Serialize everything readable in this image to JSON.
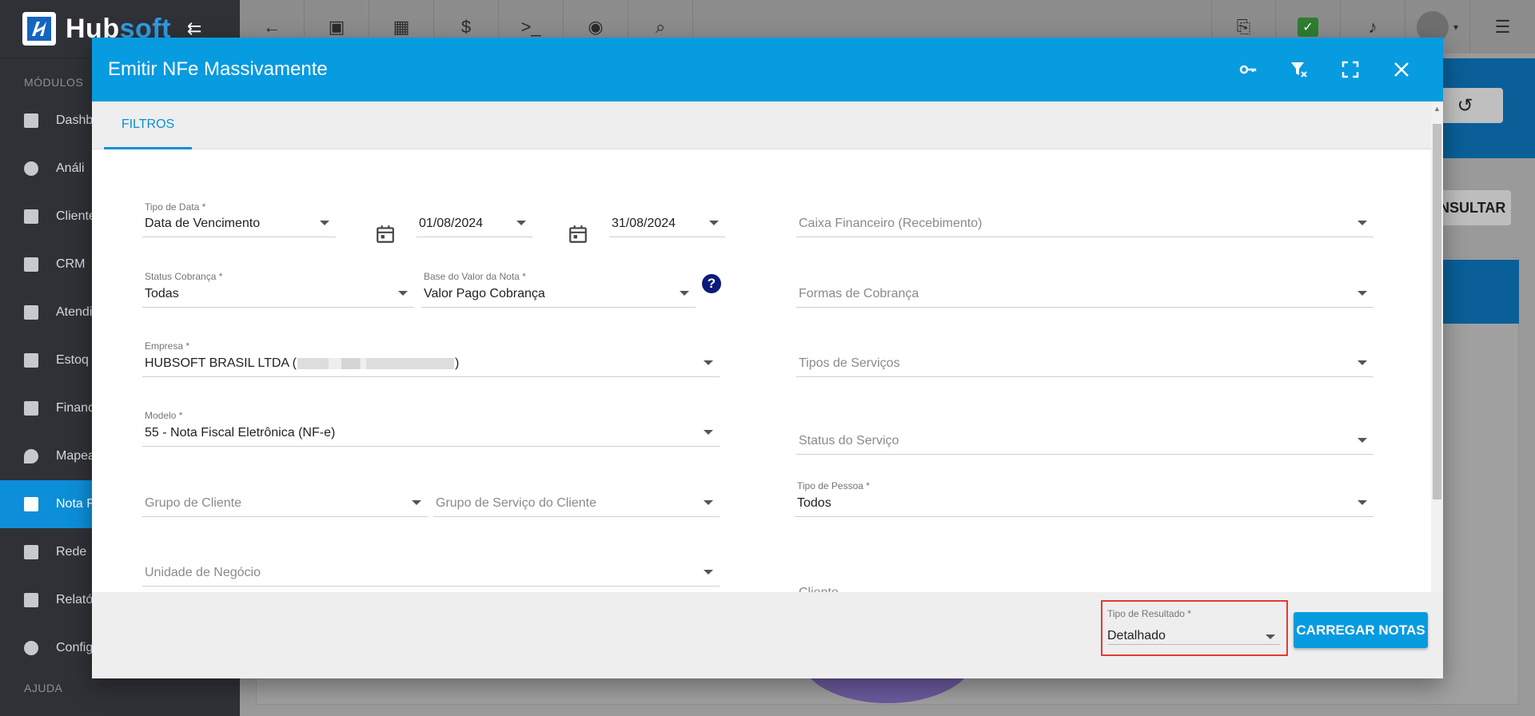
{
  "app": {
    "brand_prefix": "Hub",
    "brand_suffix": "soft"
  },
  "sidebar": {
    "section_modules": "MÓDULOS",
    "section_help": "AJUDA",
    "items": [
      {
        "label": "Dashb",
        "icon": "grid-icon"
      },
      {
        "label": "Análi",
        "icon": "chart-pie-icon"
      },
      {
        "label": "Cliente",
        "icon": "contact-card-icon"
      },
      {
        "label": "CRM",
        "icon": "board-icon"
      },
      {
        "label": "Atendi",
        "icon": "calendar-clock-icon"
      },
      {
        "label": "Estoq",
        "icon": "box-icon"
      },
      {
        "label": "Financ",
        "icon": "money-icon"
      },
      {
        "label": "Mapea",
        "icon": "map-pin-icon"
      },
      {
        "label": "Nota F",
        "icon": "invoice-icon"
      },
      {
        "label": "Rede",
        "icon": "server-icon"
      },
      {
        "label": "Relató",
        "icon": "report-icon"
      },
      {
        "label": "Config",
        "icon": "gear-icon"
      }
    ],
    "active_index": 8
  },
  "background": {
    "consultar_label": "NSULTAR"
  },
  "modal": {
    "title": "Emitir NFe Massivamente",
    "tab_label": "FILTROS",
    "fields": {
      "tipo_data": {
        "label": "Tipo de Data *",
        "value": "Data de Vencimento"
      },
      "data_inicio": {
        "value": "01/08/2024"
      },
      "data_fim": {
        "value": "31/08/2024"
      },
      "caixa_financeiro": {
        "placeholder": "Caixa Financeiro (Recebimento)"
      },
      "status_cobranca": {
        "label": "Status Cobrança *",
        "value": "Todas"
      },
      "base_valor": {
        "label": "Base do Valor da Nota *",
        "value": "Valor Pago Cobrança"
      },
      "formas_cobranca": {
        "placeholder": "Formas de Cobrança"
      },
      "empresa": {
        "label": "Empresa *",
        "value_prefix": "HUBSOFT BRASIL LTDA (",
        "value_suffix": ")"
      },
      "tipos_servicos": {
        "placeholder": "Tipos de Serviços"
      },
      "modelo": {
        "label": "Modelo *",
        "value": "55 - Nota Fiscal Eletrônica (NF-e)"
      },
      "status_servico": {
        "placeholder": "Status do Serviço"
      },
      "grupo_cliente": {
        "placeholder": "Grupo de Cliente"
      },
      "grupo_servico_cliente": {
        "placeholder": "Grupo de Serviço do Cliente"
      },
      "tipo_pessoa": {
        "label": "Tipo de Pessoa *",
        "value": "Todos"
      },
      "unidade_negocio": {
        "placeholder": "Unidade de Negócio"
      },
      "cliente": {
        "placeholder": "Cliente"
      }
    },
    "footer": {
      "tipo_resultado": {
        "label": "Tipo de Resultado *",
        "value": "Detalhado"
      },
      "carregar_label": "CARREGAR NOTAS"
    }
  },
  "colors": {
    "primary": "#079be0",
    "sidebar_bg": "#2f3136",
    "active_item": "#0d8ed9",
    "highlight_border": "#e53935",
    "help_icon": "#0c1a7a"
  }
}
